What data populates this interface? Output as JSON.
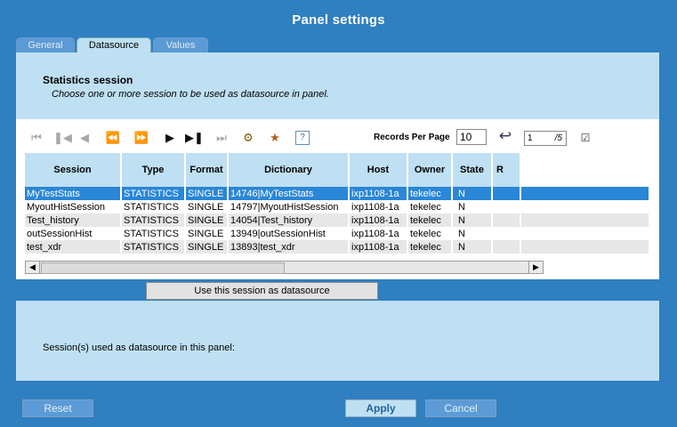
{
  "window": {
    "title": "Panel settings"
  },
  "tabs": [
    {
      "label": "General",
      "active": false
    },
    {
      "label": "Datasource",
      "active": true
    },
    {
      "label": "Values",
      "active": false
    }
  ],
  "header": {
    "title": "Statistics session",
    "subtitle": "Choose one or more session to be used as datasource in panel."
  },
  "toolbar": {
    "records_per_page_label": "Records Per Page",
    "records_per_page_value": "10",
    "current_page": "1",
    "total_pages": "/5",
    "icons": [
      "first-page-icon",
      "prev-block-icon",
      "prev-page-icon",
      "rewind-icon",
      "fast-forward-icon",
      "next-page-icon",
      "next-block-icon",
      "last-page-icon",
      "find-icon",
      "filter-icon",
      "help-icon",
      "goto-page-icon",
      "export-icon"
    ]
  },
  "table": {
    "columns": [
      "Session",
      "Type",
      "Format",
      "Dictionary",
      "Host",
      "Owner",
      "State",
      "R"
    ],
    "rows": [
      [
        "MyTestStats",
        "STATISTICS",
        "SINGLE",
        "14746|MyTestStats",
        "ixp1108-1a",
        "tekelec",
        "N",
        ""
      ],
      [
        "MyoutHistSession",
        "STATISTICS",
        "SINGLE",
        "14797|MyoutHistSession",
        "ixp1108-1a",
        "tekelec",
        "N",
        ""
      ],
      [
        "Test_history",
        "STATISTICS",
        "SINGLE",
        "14054|Test_history",
        "ixp1108-1a",
        "tekelec",
        "N",
        ""
      ],
      [
        "outSessionHist",
        "STATISTICS",
        "SINGLE",
        "13949|outSessionHist",
        "ixp1108-1a",
        "tekelec",
        "N",
        ""
      ],
      [
        "test_xdr",
        "STATISTICS",
        "SINGLE",
        "13893|test_xdr",
        "ixp1108-1a",
        "tekelec",
        "N",
        ""
      ]
    ],
    "selected_row": 0
  },
  "use_button_label": "Use this session as datasource",
  "lower": {
    "text": "Session(s) used as datasource in this panel:"
  },
  "footer": {
    "reset": "Reset",
    "apply": "Apply",
    "cancel": "Cancel"
  },
  "colors": {
    "frame": "#2f7fc1",
    "panel": "#bfe0f3",
    "selected_row": "#2a86d6"
  }
}
